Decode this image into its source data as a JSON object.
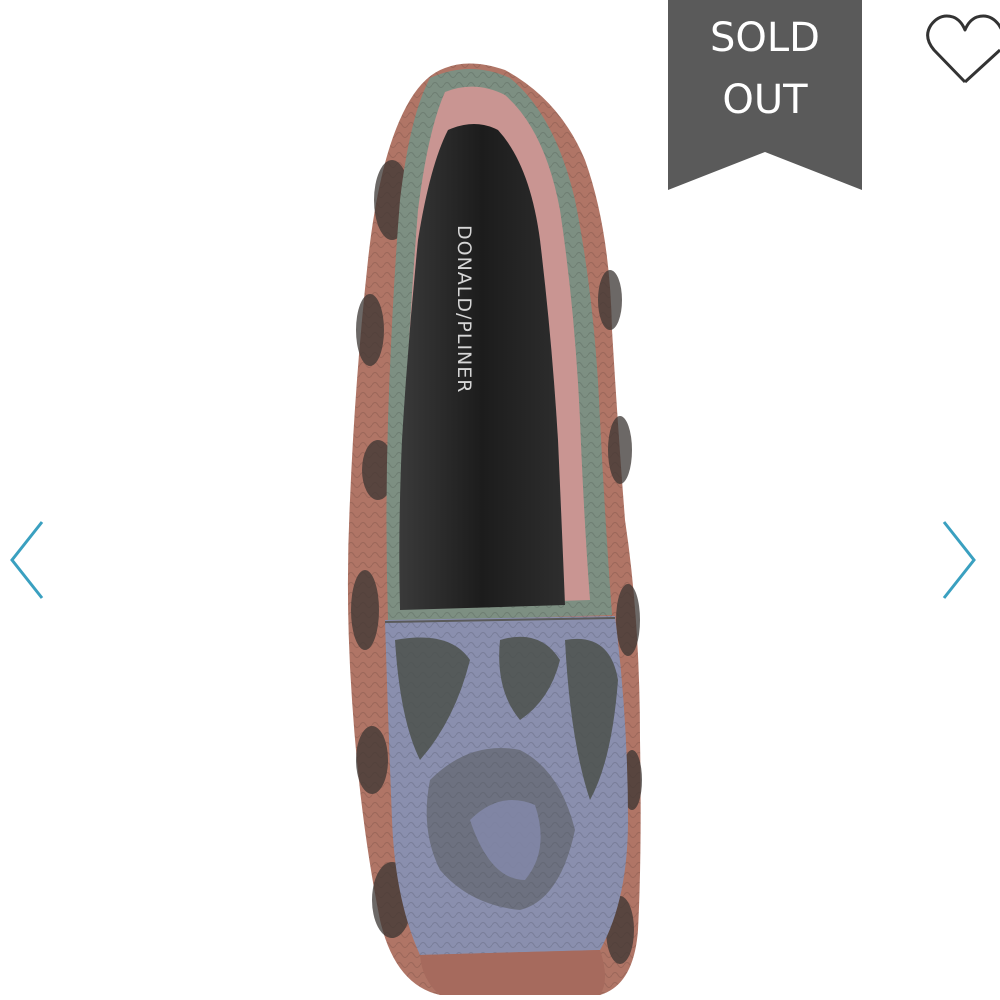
{
  "product": {
    "image_alt": "Snake print loafer, top view",
    "brand_print": "DONALD/PLINER"
  },
  "badge": {
    "line1": "SOLD",
    "line2": "OUT",
    "color": "#5a5a5a"
  },
  "icons": {
    "favorite": "heart-outline-icon",
    "previous": "chevron-left-icon",
    "next": "chevron-right-icon"
  },
  "colors": {
    "arrow": "#3aa0c0",
    "heart_stroke": "#333333"
  }
}
